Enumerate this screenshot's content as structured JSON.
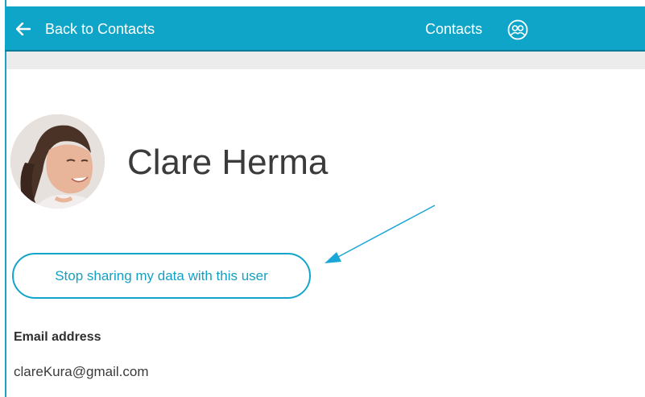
{
  "header": {
    "back_label": "Back to Contacts",
    "title": "Contacts",
    "icons": {
      "back": "arrow-left-icon",
      "contacts": "contacts-group-icon"
    }
  },
  "profile": {
    "name": "Clare Herma",
    "avatar_icon": "avatar-photo"
  },
  "actions": {
    "stop_sharing_label": "Stop sharing my data with this user"
  },
  "details": {
    "email_label": "Email address",
    "email_value": "clareKura@gmail.com"
  },
  "colors": {
    "accent": "#0ea5c9",
    "annotation_arrow": "#1aa6d6"
  }
}
